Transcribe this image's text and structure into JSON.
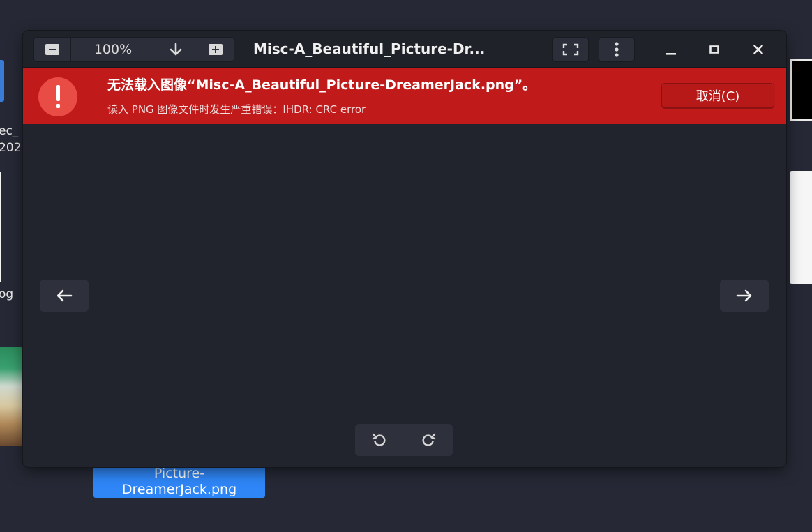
{
  "desktop": {
    "left_label_1": "ec_",
    "left_label_2": "202",
    "left_label_3": "og",
    "selected_file_line1": "Picture-",
    "selected_file_line2": "DreamerJack.png",
    "selection_color": "#2f86f7"
  },
  "window": {
    "title": "Misc-A_Beautiful_Picture-Dr...",
    "zoom_value": "100%",
    "icons": {
      "zoom_out": "zoom-out-icon",
      "zoom_options": "arrow-down-icon",
      "zoom_in": "zoom-in-icon",
      "fullscreen": "fullscreen-icon",
      "menu": "kebab-menu-icon",
      "minimize": "minimize-icon",
      "maximize": "maximize-icon",
      "close": "close-icon"
    }
  },
  "error_bar": {
    "title": "无法载入图像“Misc-A_Beautiful_Picture-DreamerJack.png”。",
    "detail": "读入 PNG 图像文件时发生严重错误：IHDR: CRC error",
    "cancel_label": "取消(C)",
    "icon": "error-exclamation-icon",
    "color": "#c01a1a"
  },
  "viewer": {
    "prev_icon": "arrow-left-icon",
    "next_icon": "arrow-right-icon",
    "rotate_left_icon": "rotate-counterclockwise-icon",
    "rotate_right_icon": "rotate-clockwise-icon"
  }
}
